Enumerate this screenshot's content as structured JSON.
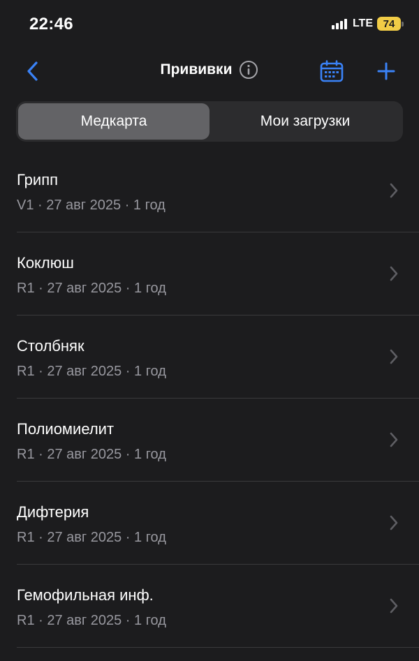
{
  "status_bar": {
    "time": "22:46",
    "network": "LTE",
    "battery": "74"
  },
  "nav": {
    "title": "Прививки"
  },
  "tabs": [
    {
      "label": "Медкарта",
      "active": true
    },
    {
      "label": "Мои загрузки",
      "active": false
    }
  ],
  "vaccines": [
    {
      "name": "Грипп",
      "details": "V1 · 27 авг 2025 · 1 год"
    },
    {
      "name": "Коклюш",
      "details": "R1 · 27 авг 2025 · 1 год"
    },
    {
      "name": "Столбняк",
      "details": "R1 · 27 авг 2025 · 1 год"
    },
    {
      "name": "Полиомиелит",
      "details": "R1 · 27 авг 2025 · 1 год"
    },
    {
      "name": "Дифтерия",
      "details": "R1 · 27 авг 2025 · 1 год"
    },
    {
      "name": "Гемофильная инф.",
      "details": "R1 · 27 авг 2025 · 1 год"
    }
  ],
  "colors": {
    "background": "#1c1c1e",
    "accent": "#3a82f7",
    "battery": "#f1cc46",
    "secondary_text": "#98989f"
  },
  "icons": [
    "back-chevron-icon",
    "info-icon",
    "calendar-icon",
    "plus-icon",
    "chevron-right-icon"
  ]
}
